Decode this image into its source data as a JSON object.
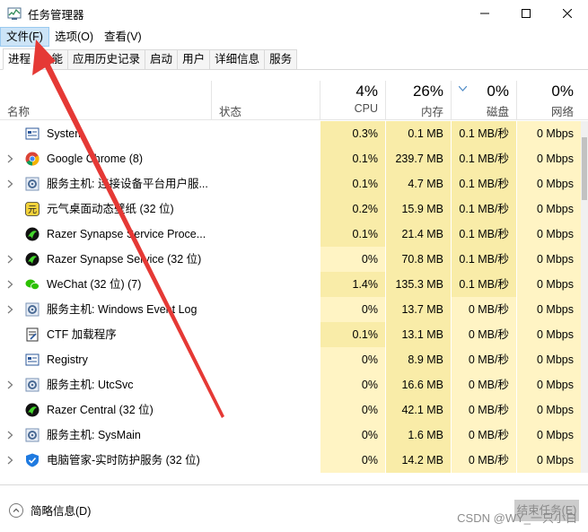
{
  "window": {
    "title": "任务管理器"
  },
  "menu": [
    "文件(F)",
    "选项(O)",
    "查看(V)"
  ],
  "tabs": [
    "进程",
    "性能",
    "应用历史记录",
    "启动",
    "用户",
    "详细信息",
    "服务"
  ],
  "header": {
    "name": "名称",
    "status": "状态",
    "cpu_pct": "4%",
    "cpu": "CPU",
    "mem_pct": "26%",
    "mem": "内存",
    "disk_pct": "0%",
    "disk": "磁盘",
    "net_pct": "0%",
    "net": "网络"
  },
  "processes": [
    {
      "name": "System",
      "expand": false,
      "icon": "system-icon",
      "cpu": "0.3%",
      "mem": "0.1 MB",
      "disk": "0.1 MB/秒",
      "net": "0 Mbps"
    },
    {
      "name": "Google Chrome (8)",
      "expand": true,
      "icon": "chrome-icon",
      "cpu": "0.1%",
      "mem": "239.7 MB",
      "disk": "0.1 MB/秒",
      "net": "0 Mbps"
    },
    {
      "name": "服务主机: 连接设备平台用户服...",
      "expand": true,
      "icon": "service-host-icon",
      "cpu": "0.1%",
      "mem": "4.7 MB",
      "disk": "0.1 MB/秒",
      "net": "0 Mbps"
    },
    {
      "name": "元气桌面动态壁纸 (32 位)",
      "expand": false,
      "icon": "wallpaper-app-icon",
      "cpu": "0.2%",
      "mem": "15.9 MB",
      "disk": "0.1 MB/秒",
      "net": "0 Mbps"
    },
    {
      "name": "Razer Synapse Service Proce...",
      "expand": false,
      "icon": "razer-icon",
      "cpu": "0.1%",
      "mem": "21.4 MB",
      "disk": "0.1 MB/秒",
      "net": "0 Mbps"
    },
    {
      "name": "Razer Synapse Service (32 位)",
      "expand": true,
      "icon": "razer-icon",
      "cpu": "0%",
      "mem": "70.8 MB",
      "disk": "0.1 MB/秒",
      "net": "0 Mbps"
    },
    {
      "name": "WeChat (32 位) (7)",
      "expand": true,
      "icon": "wechat-icon",
      "cpu": "1.4%",
      "mem": "135.3 MB",
      "disk": "0.1 MB/秒",
      "net": "0 Mbps"
    },
    {
      "name": "服务主机: Windows Event Log",
      "expand": true,
      "icon": "service-host-icon",
      "cpu": "0%",
      "mem": "13.7 MB",
      "disk": "0 MB/秒",
      "net": "0 Mbps"
    },
    {
      "name": "CTF 加载程序",
      "expand": false,
      "icon": "ctf-icon",
      "cpu": "0.1%",
      "mem": "13.1 MB",
      "disk": "0 MB/秒",
      "net": "0 Mbps"
    },
    {
      "name": "Registry",
      "expand": false,
      "icon": "system-icon",
      "cpu": "0%",
      "mem": "8.9 MB",
      "disk": "0 MB/秒",
      "net": "0 Mbps"
    },
    {
      "name": "服务主机: UtcSvc",
      "expand": true,
      "icon": "service-host-icon",
      "cpu": "0%",
      "mem": "16.6 MB",
      "disk": "0 MB/秒",
      "net": "0 Mbps"
    },
    {
      "name": "Razer Central (32 位)",
      "expand": false,
      "icon": "razer-icon",
      "cpu": "0%",
      "mem": "42.1 MB",
      "disk": "0 MB/秒",
      "net": "0 Mbps"
    },
    {
      "name": "服务主机: SysMain",
      "expand": true,
      "icon": "service-host-icon",
      "cpu": "0%",
      "mem": "1.6 MB",
      "disk": "0 MB/秒",
      "net": "0 Mbps"
    },
    {
      "name": "电脑管家-实时防护服务 (32 位)",
      "expand": true,
      "icon": "shield-icon",
      "cpu": "0%",
      "mem": "14.2 MB",
      "disk": "0 MB/秒",
      "net": "0 Mbps"
    }
  ],
  "footer": {
    "fewer_details": "简略信息(D)",
    "end_task": "结束任务(E)",
    "watermark": "CSDN @WY_一只小白"
  },
  "colors": {
    "heat_light": "#fff4c4",
    "heat_mid": "#f9eca8",
    "accent": "#0078d7",
    "annotation_arrow": "#e53935"
  }
}
